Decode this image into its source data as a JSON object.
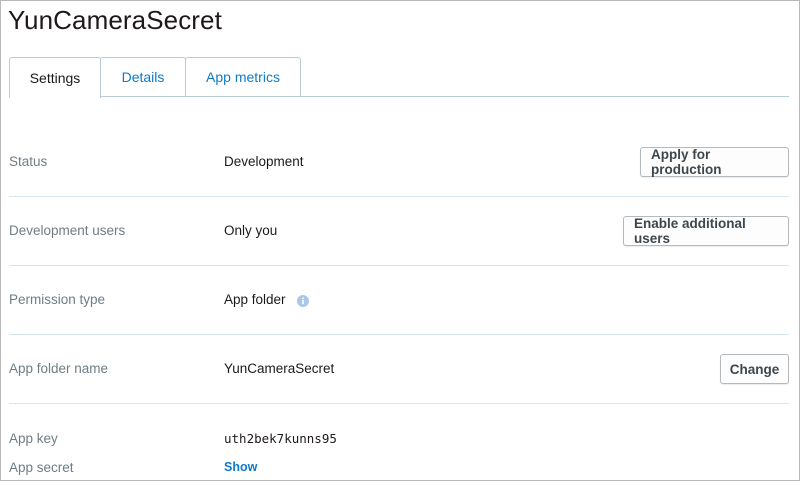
{
  "app": {
    "title": "YunCameraSecret"
  },
  "tabs": [
    {
      "label": "Settings",
      "active": true
    },
    {
      "label": "Details",
      "active": false
    },
    {
      "label": "App metrics",
      "active": false
    }
  ],
  "settings": {
    "status": {
      "label": "Status",
      "value": "Development",
      "button": "Apply for production"
    },
    "dev_users": {
      "label": "Development users",
      "value": "Only you",
      "button": "Enable additional users"
    },
    "permission": {
      "label": "Permission type",
      "value": "App folder",
      "icon": "info-icon"
    },
    "folder_name": {
      "label": "App folder name",
      "value": "YunCameraSecret",
      "button": "Change"
    },
    "app_key": {
      "label": "App key",
      "value": "uth2bek7kunns95"
    },
    "app_secret": {
      "label": "App secret",
      "link": "Show"
    }
  },
  "colors": {
    "link": "#0f7ac8",
    "label": "#6e7d86",
    "divider": "#d6e6ee",
    "tab_border": "#b9cbd4"
  }
}
